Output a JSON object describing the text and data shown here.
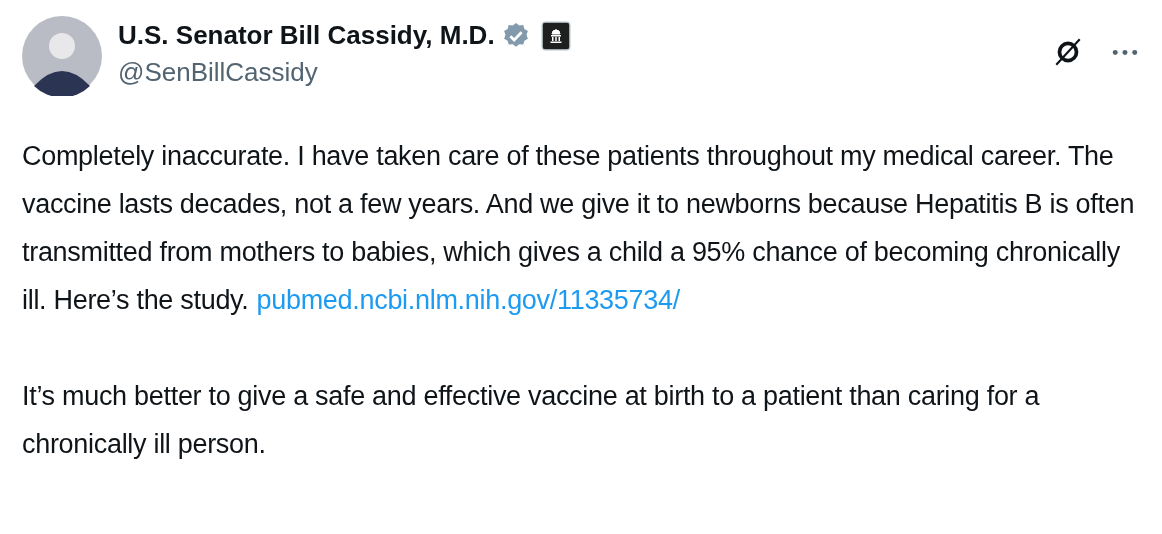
{
  "author": {
    "name": "U.S. Senator Bill Cassidy, M.D.",
    "handle": "@SenBillCassidy",
    "verified": true,
    "affiliation_badge": true
  },
  "paragraphs": [
    {
      "text": "Completely inaccurate. I have taken care of these patients throughout my medical career. The vaccine lasts decades, not a few years. And we give it to newborns because Hepatitis B  is often transmitted from mothers to babies, which gives a child a 95% chance of becoming chronically ill. Here’s the study.",
      "link": "pubmed.ncbi.nlm.nih.gov/11335734/"
    },
    {
      "text": "It’s much better to give a safe and effective vaccine at birth to a patient than caring for a chronically ill person."
    }
  ]
}
